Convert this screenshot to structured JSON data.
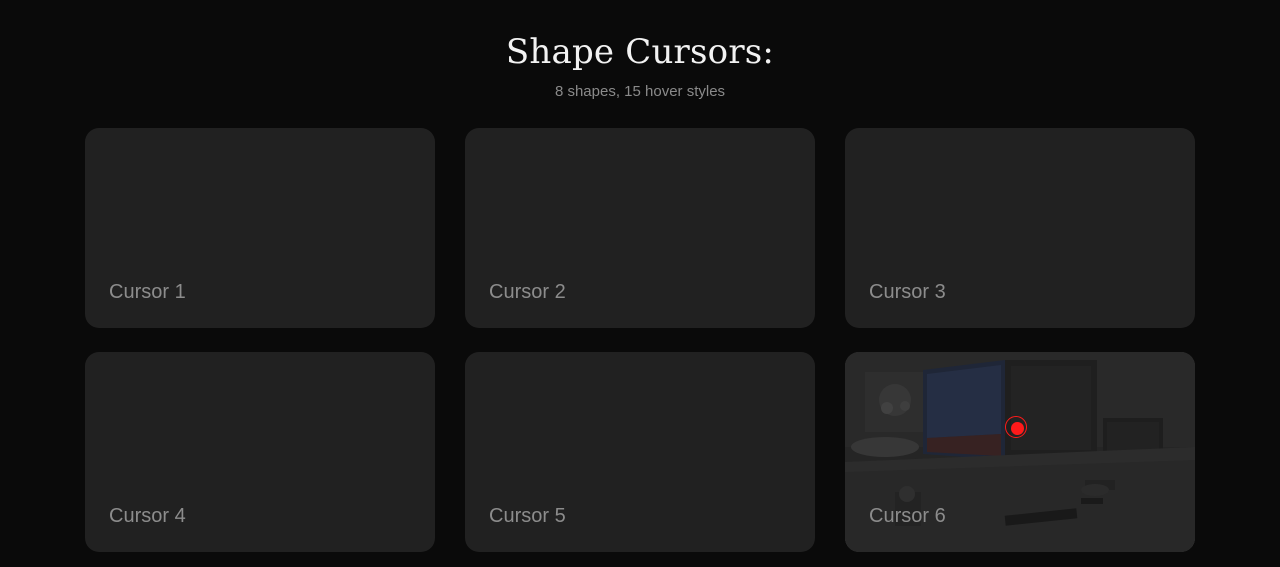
{
  "header": {
    "title": "Shape Cursors:",
    "subtitle": "8 shapes, 15 hover styles"
  },
  "cards": [
    {
      "label": "Cursor 1"
    },
    {
      "label": "Cursor 2"
    },
    {
      "label": "Cursor 3"
    },
    {
      "label": "Cursor 4"
    },
    {
      "label": "Cursor 5"
    },
    {
      "label": "Cursor 6",
      "state": "hovered",
      "background": "desk-workspace-photo",
      "cursor_shape": "ring-dot-icon"
    }
  ],
  "colors": {
    "page_background": "#0a0a0a",
    "card_background": "#212121",
    "title": "#f2f2f2",
    "subtitle": "#8a8a8a",
    "card_label": "#8c8c8c",
    "cursor_accent": "#ff1a1a"
  }
}
